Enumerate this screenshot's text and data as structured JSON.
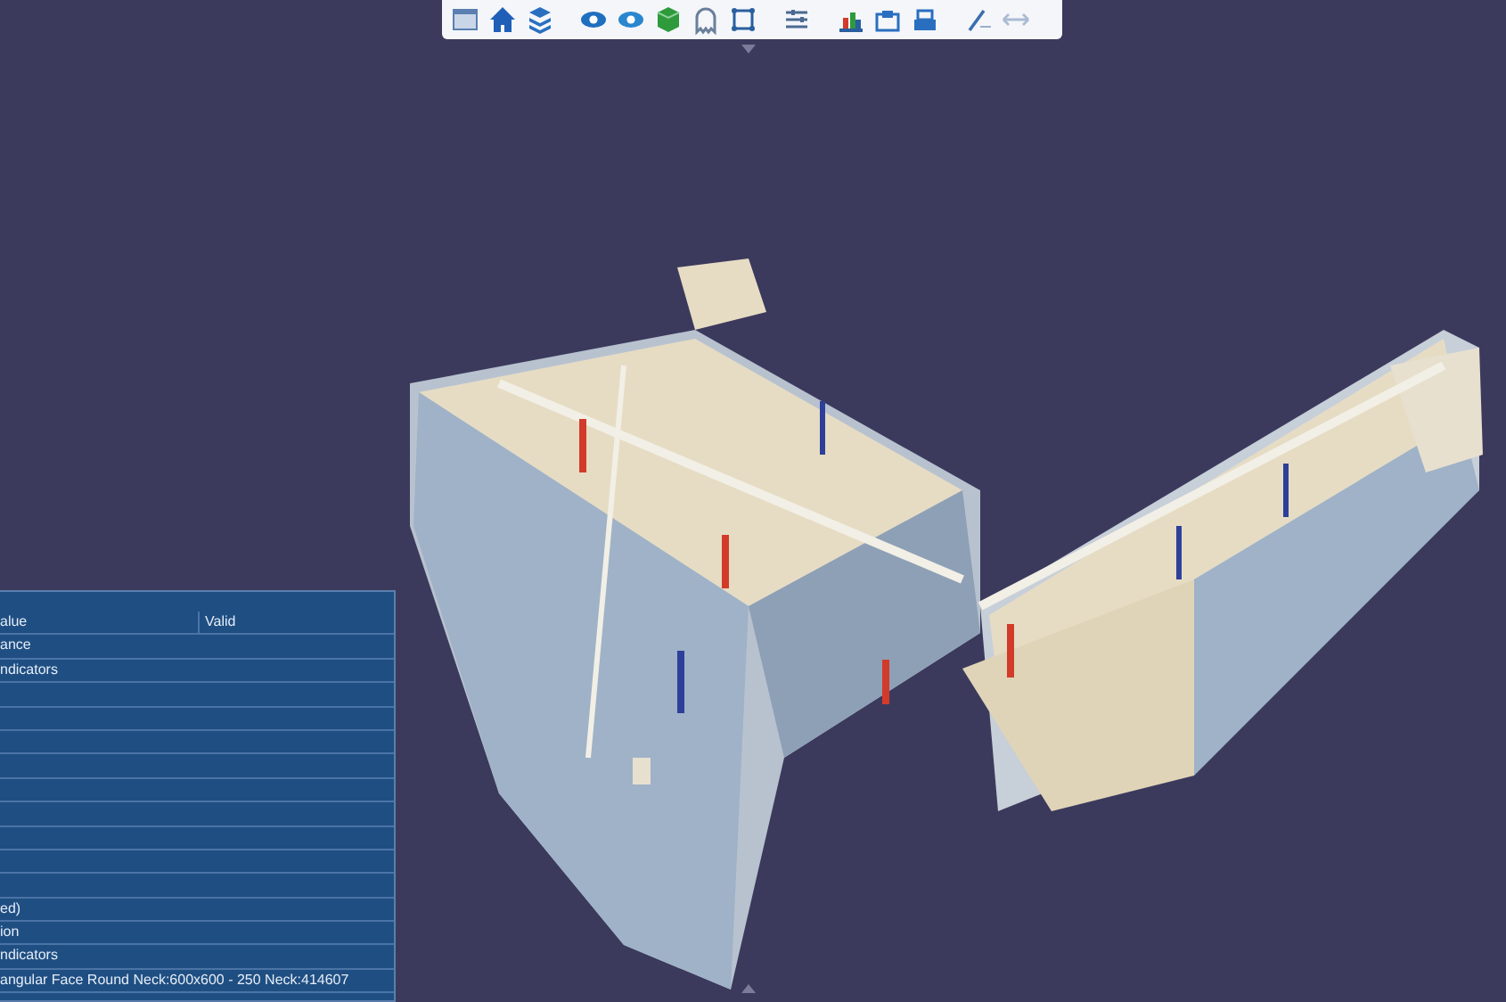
{
  "properties_panel": {
    "rows": [
      {
        "kind": "text",
        "label": "alue",
        "value": "Valid"
      },
      {
        "kind": "text",
        "label": "ance"
      },
      {
        "kind": "text",
        "label": "ndicators"
      },
      {
        "kind": "blank"
      },
      {
        "kind": "blank"
      },
      {
        "kind": "blank"
      },
      {
        "kind": "blank"
      },
      {
        "kind": "blank"
      },
      {
        "kind": "blank"
      },
      {
        "kind": "blank"
      },
      {
        "kind": "blank"
      },
      {
        "kind": "blank"
      },
      {
        "kind": "text",
        "label": "ed)"
      },
      {
        "kind": "text",
        "label": "ion"
      },
      {
        "kind": "text",
        "label": "ndicators"
      },
      {
        "kind": "text",
        "label": "angular Face Round Neck:600x600 - 250 Neck:414607"
      }
    ]
  }
}
